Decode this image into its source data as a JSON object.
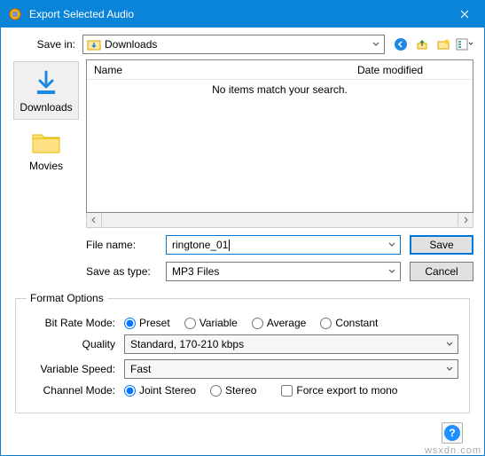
{
  "window": {
    "title": "Export Selected Audio"
  },
  "savein": {
    "label": "Save in:",
    "value": "Downloads"
  },
  "places": [
    {
      "name": "Downloads",
      "selected": true
    },
    {
      "name": "Movies",
      "selected": false
    }
  ],
  "filelist": {
    "col_name": "Name",
    "col_date": "Date modified",
    "empty": "No items match your search."
  },
  "filename": {
    "label": "File name:",
    "value": "ringtone_01"
  },
  "savetype": {
    "label": "Save as type:",
    "value": "MP3 Files"
  },
  "buttons": {
    "save": "Save",
    "cancel": "Cancel"
  },
  "format": {
    "legend": "Format Options",
    "bitrate": {
      "label": "Bit Rate Mode:",
      "options": [
        "Preset",
        "Variable",
        "Average",
        "Constant"
      ],
      "selected": "Preset"
    },
    "quality": {
      "label": "Quality",
      "value": "Standard, 170-210 kbps"
    },
    "varspeed": {
      "label": "Variable Speed:",
      "value": "Fast"
    },
    "channel": {
      "label": "Channel Mode:",
      "options": [
        "Joint Stereo",
        "Stereo"
      ],
      "selected": "Joint Stereo",
      "force_mono": "Force export to mono",
      "force_mono_checked": false
    }
  },
  "watermark": "wsxdn.com"
}
